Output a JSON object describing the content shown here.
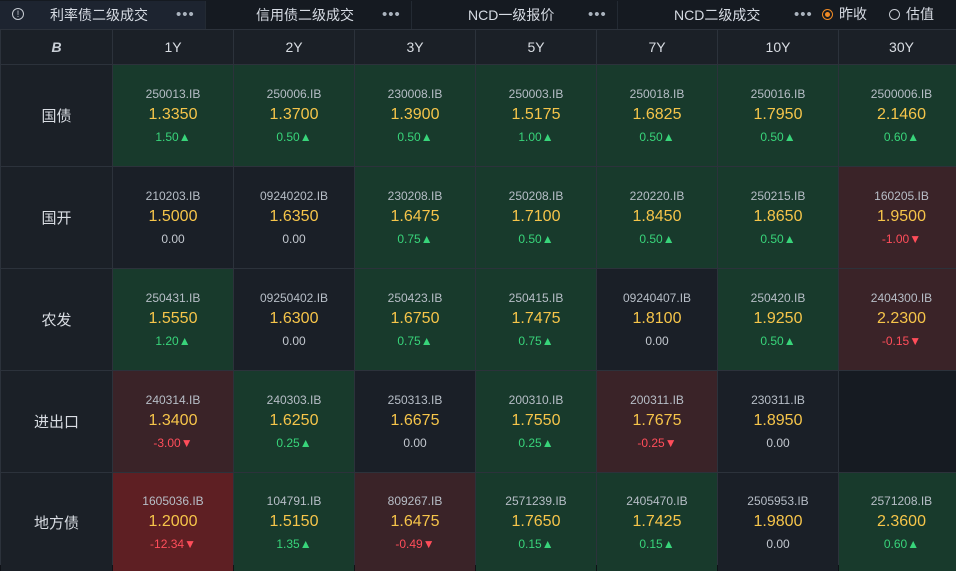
{
  "tabs": [
    {
      "label": "利率债二级成交",
      "more": "•••",
      "active": true
    },
    {
      "label": "信用债二级成交",
      "more": "•••",
      "active": false
    },
    {
      "label": "NCD一级报价",
      "more": "•••",
      "active": false
    },
    {
      "label": "NCD二级成交",
      "more": "•••",
      "active": false
    }
  ],
  "radio": [
    {
      "label": "昨收",
      "checked": true
    },
    {
      "label": "估值",
      "checked": false
    }
  ],
  "logo": "B",
  "columns": [
    "1Y",
    "2Y",
    "3Y",
    "5Y",
    "7Y",
    "10Y",
    "30Y"
  ],
  "rows": [
    {
      "label": "国债",
      "cells": [
        {
          "code": "250013.IB",
          "value": "1.3350",
          "change": "1.50▲",
          "trend": "up"
        },
        {
          "code": "250006.IB",
          "value": "1.3700",
          "change": "0.50▲",
          "trend": "up"
        },
        {
          "code": "230008.IB",
          "value": "1.3900",
          "change": "0.50▲",
          "trend": "up"
        },
        {
          "code": "250003.IB",
          "value": "1.5175",
          "change": "1.00▲",
          "trend": "up"
        },
        {
          "code": "250018.IB",
          "value": "1.6825",
          "change": "0.50▲",
          "trend": "up"
        },
        {
          "code": "250016.IB",
          "value": "1.7950",
          "change": "0.50▲",
          "trend": "up"
        },
        {
          "code": "2500006.IB",
          "value": "2.1460",
          "change": "0.60▲",
          "trend": "up"
        }
      ]
    },
    {
      "label": "国开",
      "cells": [
        {
          "code": "210203.IB",
          "value": "1.5000",
          "change": "0.00",
          "trend": "flat"
        },
        {
          "code": "09240202.IB",
          "value": "1.6350",
          "change": "0.00",
          "trend": "flat"
        },
        {
          "code": "230208.IB",
          "value": "1.6475",
          "change": "0.75▲",
          "trend": "up"
        },
        {
          "code": "250208.IB",
          "value": "1.7100",
          "change": "0.50▲",
          "trend": "up"
        },
        {
          "code": "220220.IB",
          "value": "1.8450",
          "change": "0.50▲",
          "trend": "up"
        },
        {
          "code": "250215.IB",
          "value": "1.8650",
          "change": "0.50▲",
          "trend": "up"
        },
        {
          "code": "160205.IB",
          "value": "1.9500",
          "change": "-1.00▼",
          "trend": "down"
        }
      ]
    },
    {
      "label": "农发",
      "cells": [
        {
          "code": "250431.IB",
          "value": "1.5550",
          "change": "1.20▲",
          "trend": "up"
        },
        {
          "code": "09250402.IB",
          "value": "1.6300",
          "change": "0.00",
          "trend": "flat"
        },
        {
          "code": "250423.IB",
          "value": "1.6750",
          "change": "0.75▲",
          "trend": "up"
        },
        {
          "code": "250415.IB",
          "value": "1.7475",
          "change": "0.75▲",
          "trend": "up"
        },
        {
          "code": "09240407.IB",
          "value": "1.8100",
          "change": "0.00",
          "trend": "flat"
        },
        {
          "code": "250420.IB",
          "value": "1.9250",
          "change": "0.50▲",
          "trend": "up"
        },
        {
          "code": "2404300.IB",
          "value": "2.2300",
          "change": "-0.15▼",
          "trend": "down"
        }
      ]
    },
    {
      "label": "进出口",
      "cells": [
        {
          "code": "240314.IB",
          "value": "1.3400",
          "change": "-3.00▼",
          "trend": "down"
        },
        {
          "code": "240303.IB",
          "value": "1.6250",
          "change": "0.25▲",
          "trend": "up"
        },
        {
          "code": "250313.IB",
          "value": "1.6675",
          "change": "0.00",
          "trend": "flat"
        },
        {
          "code": "200310.IB",
          "value": "1.7550",
          "change": "0.25▲",
          "trend": "up"
        },
        {
          "code": "200311.IB",
          "value": "1.7675",
          "change": "-0.25▼",
          "trend": "down"
        },
        {
          "code": "230311.IB",
          "value": "1.8950",
          "change": "0.00",
          "trend": "flat"
        },
        null
      ]
    },
    {
      "label": "地方债",
      "cells": [
        {
          "code": "1605036.IB",
          "value": "1.2000",
          "change": "-12.34▼",
          "trend": "down-strong"
        },
        {
          "code": "104791.IB",
          "value": "1.5150",
          "change": "1.35▲",
          "trend": "up"
        },
        {
          "code": "809267.IB",
          "value": "1.6475",
          "change": "-0.49▼",
          "trend": "down"
        },
        {
          "code": "2571239.IB",
          "value": "1.7650",
          "change": "0.15▲",
          "trend": "up"
        },
        {
          "code": "2405470.IB",
          "value": "1.7425",
          "change": "0.15▲",
          "trend": "up"
        },
        {
          "code": "2505953.IB",
          "value": "1.9800",
          "change": "0.00",
          "trend": "flat"
        },
        {
          "code": "2571208.IB",
          "value": "2.3600",
          "change": "0.60▲",
          "trend": "up"
        }
      ]
    }
  ]
}
